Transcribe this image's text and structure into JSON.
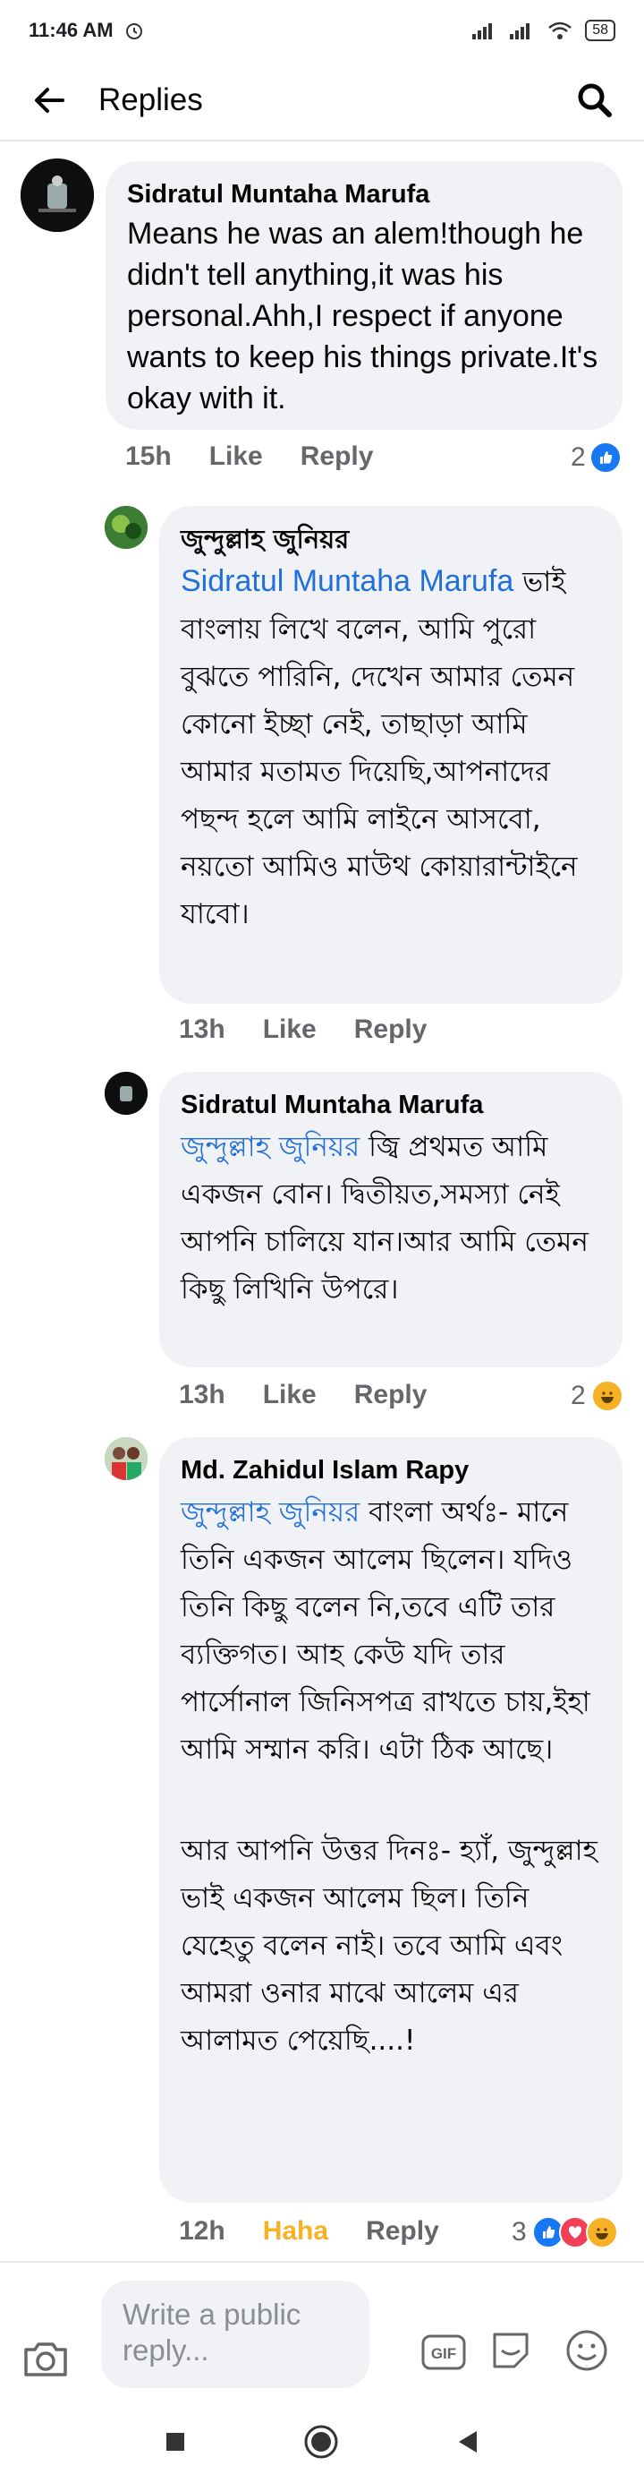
{
  "status_bar": {
    "time": "11:46 AM",
    "battery": "58"
  },
  "header": {
    "title": "Replies"
  },
  "comments": [
    {
      "author": "Sidratul Muntaha Marufa",
      "text": "Means he was an alem!though he didn't tell anything,it was his personal.Ahh,I respect if anyone wants to keep his things private.It's okay with it.",
      "time": "15h",
      "like": "Like",
      "reply": "Reply",
      "reaction_count": "2"
    },
    {
      "author": "জুন্দুল্লাহ জুনিয়র",
      "mention": "Sidratul Muntaha Marufa",
      "text": " ভাই বাংলায় লিখে বলেন, আমি পুরো বুঝতে পারিনি, দেখেন আমার তেমন কোনো ইচ্ছা নেই, তাছাড়া আমি আমার মতামত দিয়েছি,আপনাদের পছন্দ হলে আমি লাইনে আসবো, নয়তো আমিও মাউথ কোয়ারান্টাইনে যাবো।",
      "time": "13h",
      "like": "Like",
      "reply": "Reply"
    },
    {
      "author": "Sidratul Muntaha Marufa",
      "mention": "জুন্দুল্লাহ জুনিয়র",
      "text": " জ্বি প্রথমত আমি একজন বোন। দ্বিতীয়ত,সমস্যা নেই আপনি চালিয়ে যান।আর আমি তেমন কিছু লিখিনি উপরে।",
      "time": "13h",
      "like": "Like",
      "reply": "Reply",
      "reaction_count": "2"
    },
    {
      "author": "Md. Zahidul Islam Rapy",
      "mention": "জুন্দুল্লাহ জুনিয়র",
      "text": "  বাংলা অর্থঃ- মানে তিনি একজন আলেম ছিলেন। যদিও তিনি কিছু বলেন নি,তবে এটি তার ব্যক্তিগত। আহ কেউ যদি তার পার্সোনাল জিনিসপত্র রাখতে চায়,ইহা আমি সম্মান করি। এটা ঠিক আছে।",
      "text2": "আর আপনি উত্তর দিনঃ- হ্যাঁ, জুন্দুল্লাহ ভাই একজন আলেম ছিল। তিনি যেহেতু বলেন নাই। তবে আমি এবং আমরা ওনার মাঝে আলেম এর আলামত পেয়েছি....!",
      "time": "12h",
      "like": "Haha",
      "reply": "Reply",
      "reaction_count": "3"
    }
  ],
  "composer": {
    "placeholder": "Write a public reply..."
  },
  "colors": {
    "accent": "#216fdb",
    "haha": "#f7b125",
    "bubble": "#f0f2f5",
    "meta": "#65676b"
  },
  "icons": [
    "back-arrow-icon",
    "search-icon",
    "like-reaction-icon",
    "love-reaction-icon",
    "haha-reaction-icon",
    "camera-icon",
    "gif-icon",
    "sticker-icon",
    "emoji-icon",
    "stop-icon",
    "home-icon",
    "back-icon"
  ]
}
